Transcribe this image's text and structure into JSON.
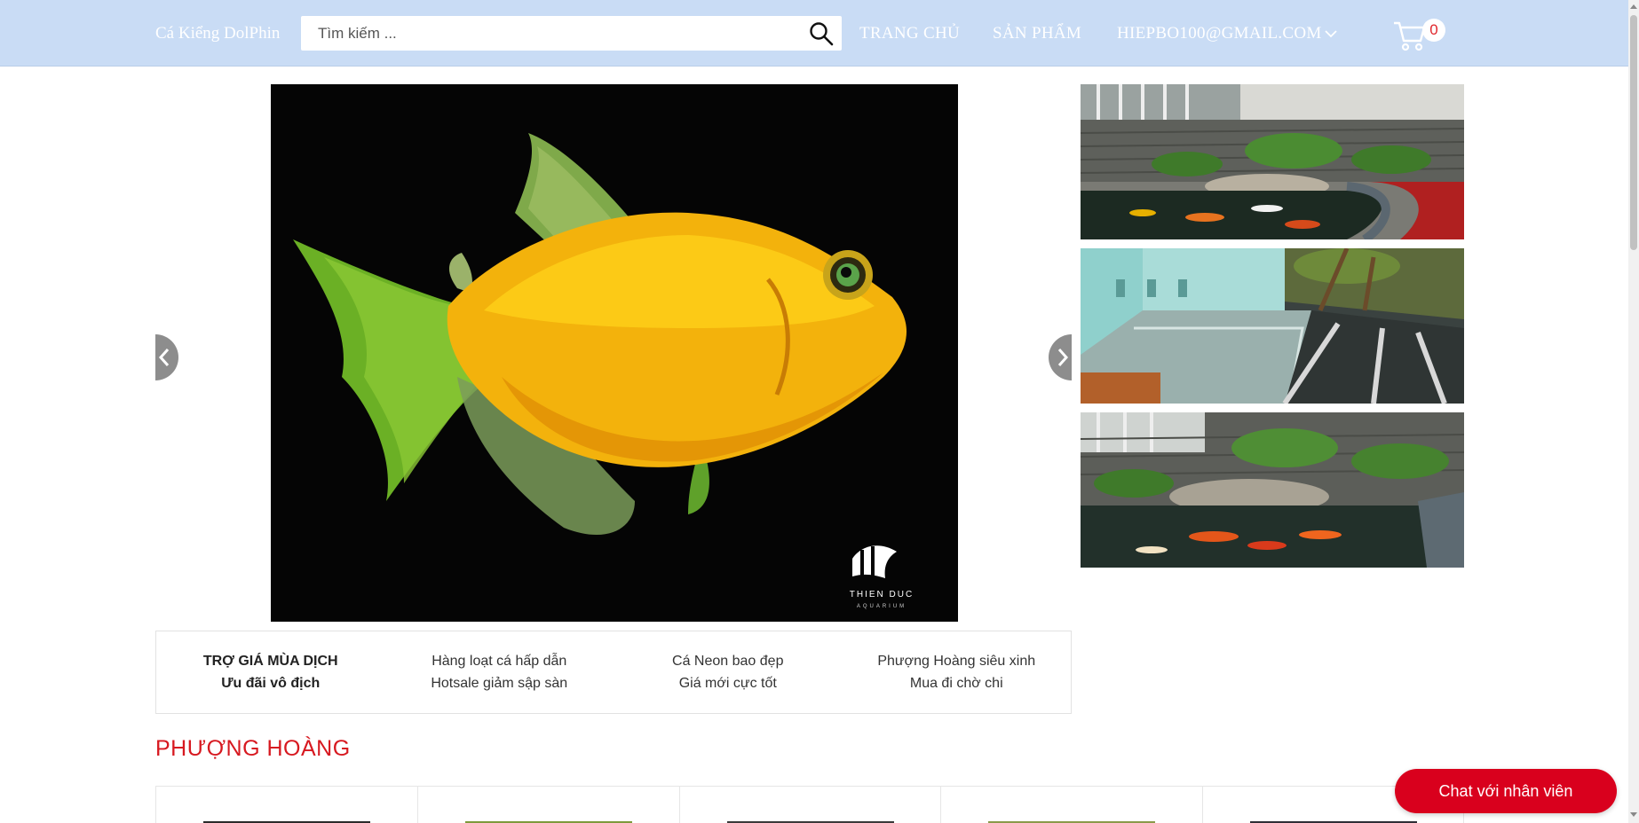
{
  "header": {
    "brand": "Cá Kiểng DolPhin",
    "search_placeholder": "Tìm kiếm ...",
    "nav": {
      "home": "TRANG CHỦ",
      "products": "SẢN PHẨM",
      "account": "HIEPBO100@GMAIL.COM"
    },
    "cart_count": "0"
  },
  "slider": {
    "watermark_line1": "THIEN DUC",
    "watermark_line2": "AQUARIUM"
  },
  "promo": [
    {
      "line1": "TRỢ GIÁ MÙA DỊCH",
      "line2": "Ưu đãi vô địch"
    },
    {
      "line1": "Hàng loạt cá hấp dẫn",
      "line2": "Hotsale giảm sập sàn"
    },
    {
      "line1": "Cá Neon bao đẹp",
      "line2": "Giá mới cực tốt"
    },
    {
      "line1": "Phượng Hoàng siêu xinh",
      "line2": "Mua đi chờ chi"
    }
  ],
  "section": {
    "title": "PHƯỢNG HOÀNG"
  },
  "chat": {
    "label": "Chat với nhân viên"
  },
  "colors": {
    "header_bg": "#c9dcf5",
    "accent": "#d71920",
    "chat_bg": "#d9001d"
  }
}
